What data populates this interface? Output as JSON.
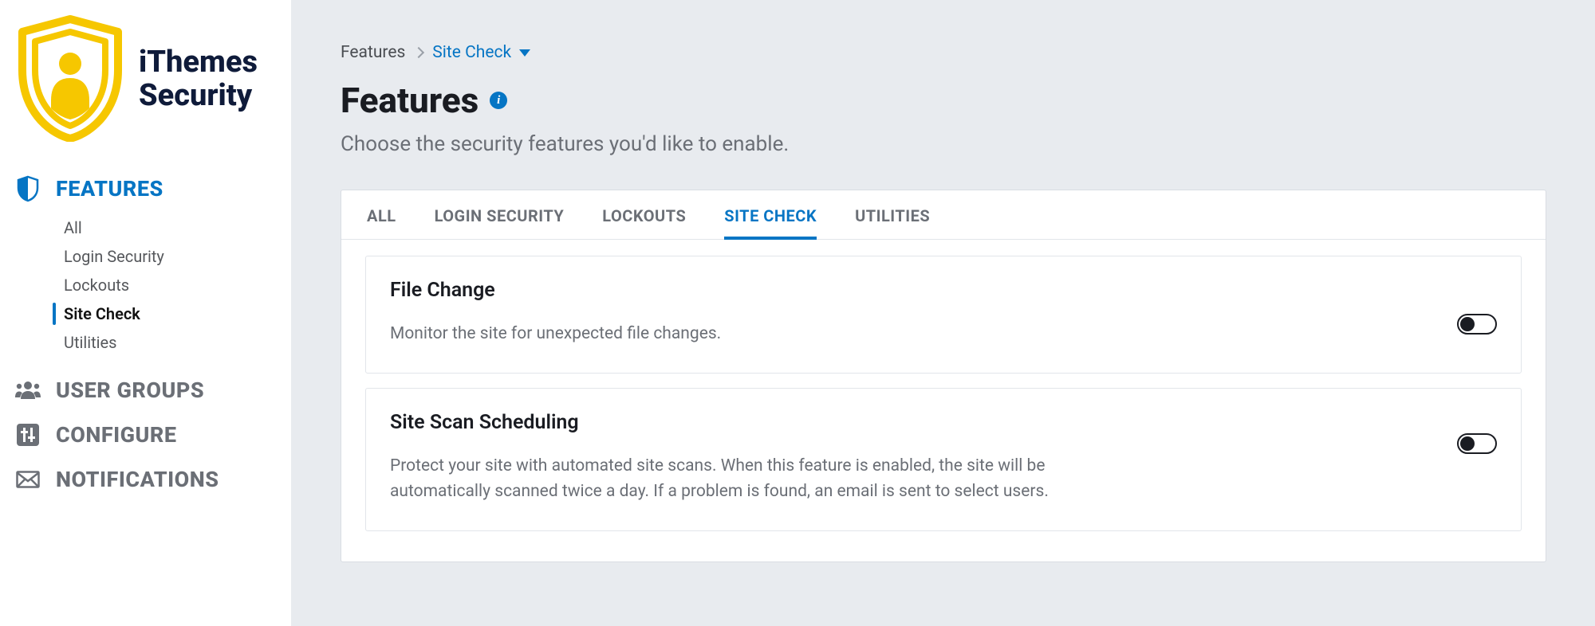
{
  "brand": {
    "line1": "iThemes",
    "line2": "Security"
  },
  "sidebar": {
    "sections": [
      {
        "label": "FEATURES",
        "active": true
      },
      {
        "label": "USER GROUPS",
        "active": false
      },
      {
        "label": "CONFIGURE",
        "active": false
      },
      {
        "label": "NOTIFICATIONS",
        "active": false
      }
    ],
    "feature_items": [
      {
        "label": "All",
        "active": false
      },
      {
        "label": "Login Security",
        "active": false
      },
      {
        "label": "Lockouts",
        "active": false
      },
      {
        "label": "Site Check",
        "active": true
      },
      {
        "label": "Utilities",
        "active": false
      }
    ]
  },
  "breadcrumb": {
    "root": "Features",
    "current": "Site Check"
  },
  "page": {
    "title": "Features",
    "subtitle": "Choose the security features you'd like to enable."
  },
  "tabs": [
    {
      "label": "ALL",
      "active": false
    },
    {
      "label": "LOGIN SECURITY",
      "active": false
    },
    {
      "label": "LOCKOUTS",
      "active": false
    },
    {
      "label": "SITE CHECK",
      "active": true
    },
    {
      "label": "UTILITIES",
      "active": false
    }
  ],
  "cards": [
    {
      "title": "File Change",
      "desc": "Monitor the site for unexpected file changes.",
      "enabled": false
    },
    {
      "title": "Site Scan Scheduling",
      "desc": "Protect your site with automated site scans. When this feature is enabled, the site will be automatically scanned twice a day. If a problem is found, an email is sent to select users.",
      "enabled": false
    }
  ],
  "colors": {
    "accent": "#0675c4",
    "brand_yellow": "#f6c700",
    "brand_navy": "#0f1b3a"
  }
}
